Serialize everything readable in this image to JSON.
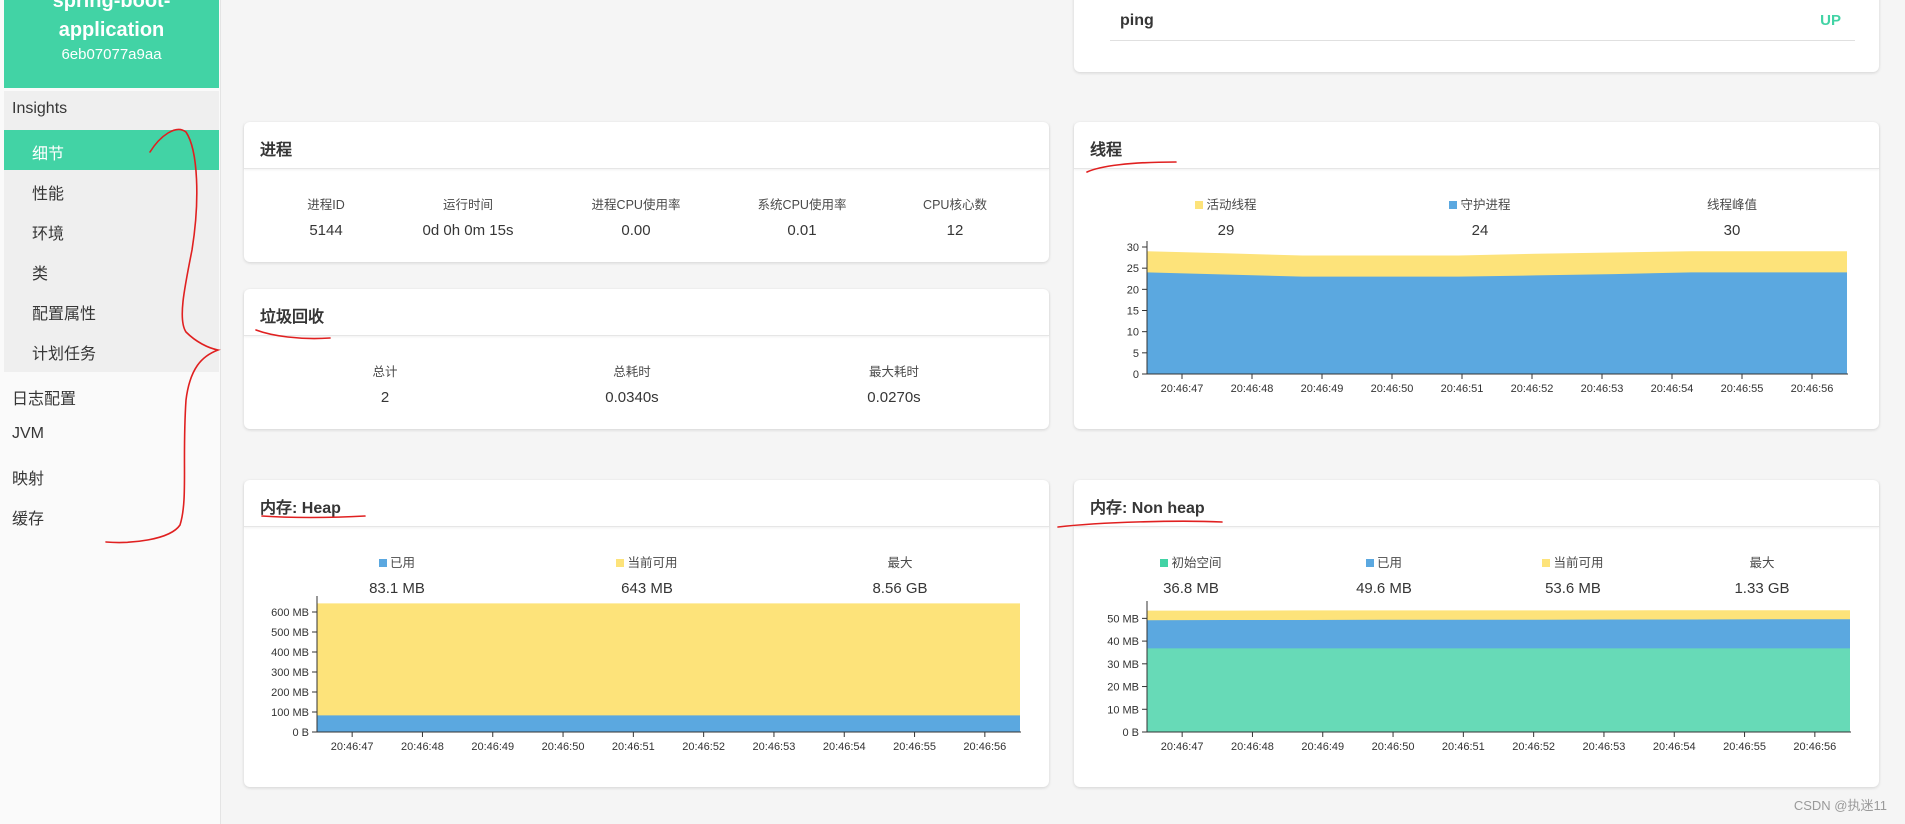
{
  "app": {
    "name": "spring-boot-application",
    "id": "6eb07077a9aa"
  },
  "colors": {
    "accent": "#42d3a5",
    "blue": "#5ba8e0",
    "yellow": "#fde37a",
    "green": "#67dab7",
    "status_up": "#42d3a5",
    "annotation": "#e02020"
  },
  "sidebar": {
    "group_label": "Insights",
    "sub_items": [
      "细节",
      "性能",
      "环境",
      "类",
      "配置属性",
      "计划任务"
    ],
    "active_index": 0,
    "items": [
      "日志配置",
      "JVM",
      "映射",
      "缓存"
    ]
  },
  "health": {
    "name": "ping",
    "status": "UP"
  },
  "process": {
    "title": "进程",
    "stats": [
      {
        "label": "进程ID",
        "value": "5144"
      },
      {
        "label": "运行时间",
        "value": "0d 0h 0m 15s"
      },
      {
        "label": "进程CPU使用率",
        "value": "0.00"
      },
      {
        "label": "系统CPU使用率",
        "value": "0.01"
      },
      {
        "label": "CPU核心数",
        "value": "12"
      }
    ]
  },
  "gc": {
    "title": "垃圾回收",
    "stats": [
      {
        "label": "总计",
        "value": "2"
      },
      {
        "label": "总耗时",
        "value": "0.0340s"
      },
      {
        "label": "最大耗时",
        "value": "0.0270s"
      }
    ]
  },
  "threads": {
    "title": "线程",
    "stats": [
      {
        "label": "活动线程",
        "value": "29",
        "swatch": "yellow"
      },
      {
        "label": "守护进程",
        "value": "24",
        "swatch": "blue"
      },
      {
        "label": "线程峰值",
        "value": "30",
        "swatch": ""
      }
    ]
  },
  "heap": {
    "title": "内存: Heap",
    "stats": [
      {
        "label": "已用",
        "value": "83.1 MB",
        "swatch": "blue"
      },
      {
        "label": "当前可用",
        "value": "643 MB",
        "swatch": "yellow"
      },
      {
        "label": "最大",
        "value": "8.56 GB",
        "swatch": ""
      }
    ]
  },
  "nonheap": {
    "title": "内存: Non heap",
    "stats": [
      {
        "label": "初始空间",
        "value": "36.8 MB",
        "swatch": "green"
      },
      {
        "label": "已用",
        "value": "49.6 MB",
        "swatch": "blue"
      },
      {
        "label": "当前可用",
        "value": "53.6 MB",
        "swatch": "yellow"
      },
      {
        "label": "最大",
        "value": "1.33 GB",
        "swatch": ""
      }
    ]
  },
  "chart_data": [
    {
      "id": "threads-chart",
      "type": "area",
      "x": [
        "20:46:47",
        "20:46:48",
        "20:46:49",
        "20:46:50",
        "20:46:51",
        "20:46:52",
        "20:46:53",
        "20:46:54",
        "20:46:55",
        "20:46:56"
      ],
      "ylim": [
        0,
        30
      ],
      "yticks": [
        "0",
        "5",
        "10",
        "15",
        "20",
        "25",
        "30"
      ],
      "ytick_values": [
        0,
        5,
        10,
        15,
        20,
        25,
        30
      ],
      "series": [
        {
          "name": "守护进程",
          "color": "#5ba8e0",
          "values": [
            24,
            23.5,
            23,
            23,
            23,
            23.3,
            23.6,
            24,
            24,
            24
          ]
        },
        {
          "name": "活动线程",
          "color": "#fde37a",
          "values": [
            29,
            28.5,
            28,
            28,
            28,
            28.4,
            28.7,
            29,
            29,
            29
          ]
        }
      ]
    },
    {
      "id": "heap-chart",
      "type": "area",
      "x": [
        "20:46:47",
        "20:46:48",
        "20:46:49",
        "20:46:50",
        "20:46:51",
        "20:46:52",
        "20:46:53",
        "20:46:54",
        "20:46:55",
        "20:46:56"
      ],
      "ylim": [
        0,
        650
      ],
      "yticks": [
        "0 B",
        "100 MB",
        "200 MB",
        "300 MB",
        "400 MB",
        "500 MB",
        "600 MB"
      ],
      "ytick_values": [
        0,
        100,
        200,
        300,
        400,
        500,
        600
      ],
      "series": [
        {
          "name": "已用",
          "color": "#5ba8e0",
          "values": [
            83.1,
            83.1,
            83.1,
            83.1,
            83.1,
            83.1,
            83.1,
            83.1,
            83.1,
            83.1
          ]
        },
        {
          "name": "当前可用",
          "color": "#fde37a",
          "values": [
            643,
            643,
            643,
            643,
            643,
            643,
            643,
            643,
            643,
            643
          ]
        }
      ]
    },
    {
      "id": "nonheap-chart",
      "type": "area",
      "x": [
        "20:46:47",
        "20:46:48",
        "20:46:49",
        "20:46:50",
        "20:46:51",
        "20:46:52",
        "20:46:53",
        "20:46:54",
        "20:46:55",
        "20:46:56"
      ],
      "ylim": [
        0,
        55
      ],
      "yticks": [
        "0 B",
        "10 MB",
        "20 MB",
        "30 MB",
        "40 MB",
        "50 MB"
      ],
      "ytick_values": [
        0,
        10,
        20,
        30,
        40,
        50
      ],
      "series": [
        {
          "name": "初始空间",
          "color": "#67dab7",
          "values": [
            36.8,
            36.8,
            36.8,
            36.8,
            36.8,
            36.8,
            36.8,
            36.8,
            36.8,
            36.8
          ]
        },
        {
          "name": "已用",
          "color": "#5ba8e0",
          "values": [
            49.2,
            49.3,
            49.3,
            49.4,
            49.4,
            49.4,
            49.5,
            49.5,
            49.6,
            49.6
          ]
        },
        {
          "name": "当前可用",
          "color": "#fde37a",
          "values": [
            53.4,
            53.4,
            53.5,
            53.5,
            53.5,
            53.5,
            53.5,
            53.6,
            53.6,
            53.6
          ]
        }
      ]
    }
  ],
  "watermark": "CSDN @执迷11"
}
